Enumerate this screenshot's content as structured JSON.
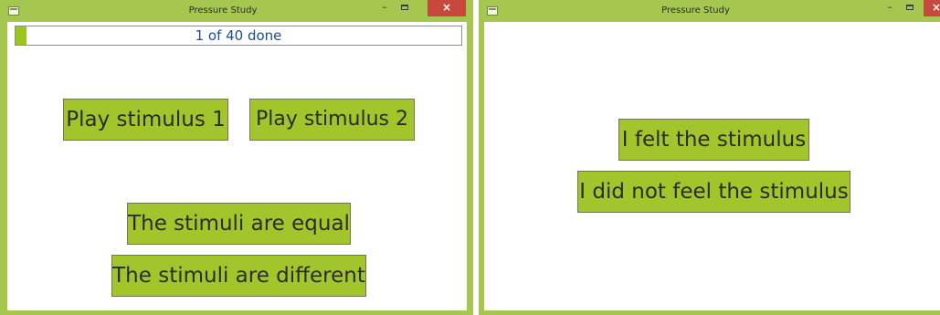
{
  "windows": [
    {
      "title": "Pressure Study",
      "controls": {
        "minimize": "–",
        "maximize": "□",
        "close": "×"
      },
      "progress": {
        "label": "1 of 40 done",
        "done": 1,
        "total": 40,
        "fraction": 0.025
      },
      "buttons": {
        "play_1": "Play stimulus 1",
        "play_2": "Play stimulus 2",
        "equal": "The stimuli are equal",
        "different": "The stimuli are different"
      }
    },
    {
      "title": "Pressure Study",
      "controls": {
        "minimize": "–",
        "maximize": "□",
        "close": "×"
      },
      "buttons": {
        "felt": "I felt the stimulus",
        "not_felt": "I did not feel the stimulus"
      }
    }
  ],
  "colors": {
    "window_frame": "#a6c74f",
    "button_fill": "#a2c52c",
    "progress_fill": "#9dc51f",
    "progress_text": "#1f4e8c",
    "close_button": "#c7493e"
  },
  "icons": [
    "app-icon",
    "minimize-icon",
    "maximize-icon",
    "close-icon"
  ]
}
